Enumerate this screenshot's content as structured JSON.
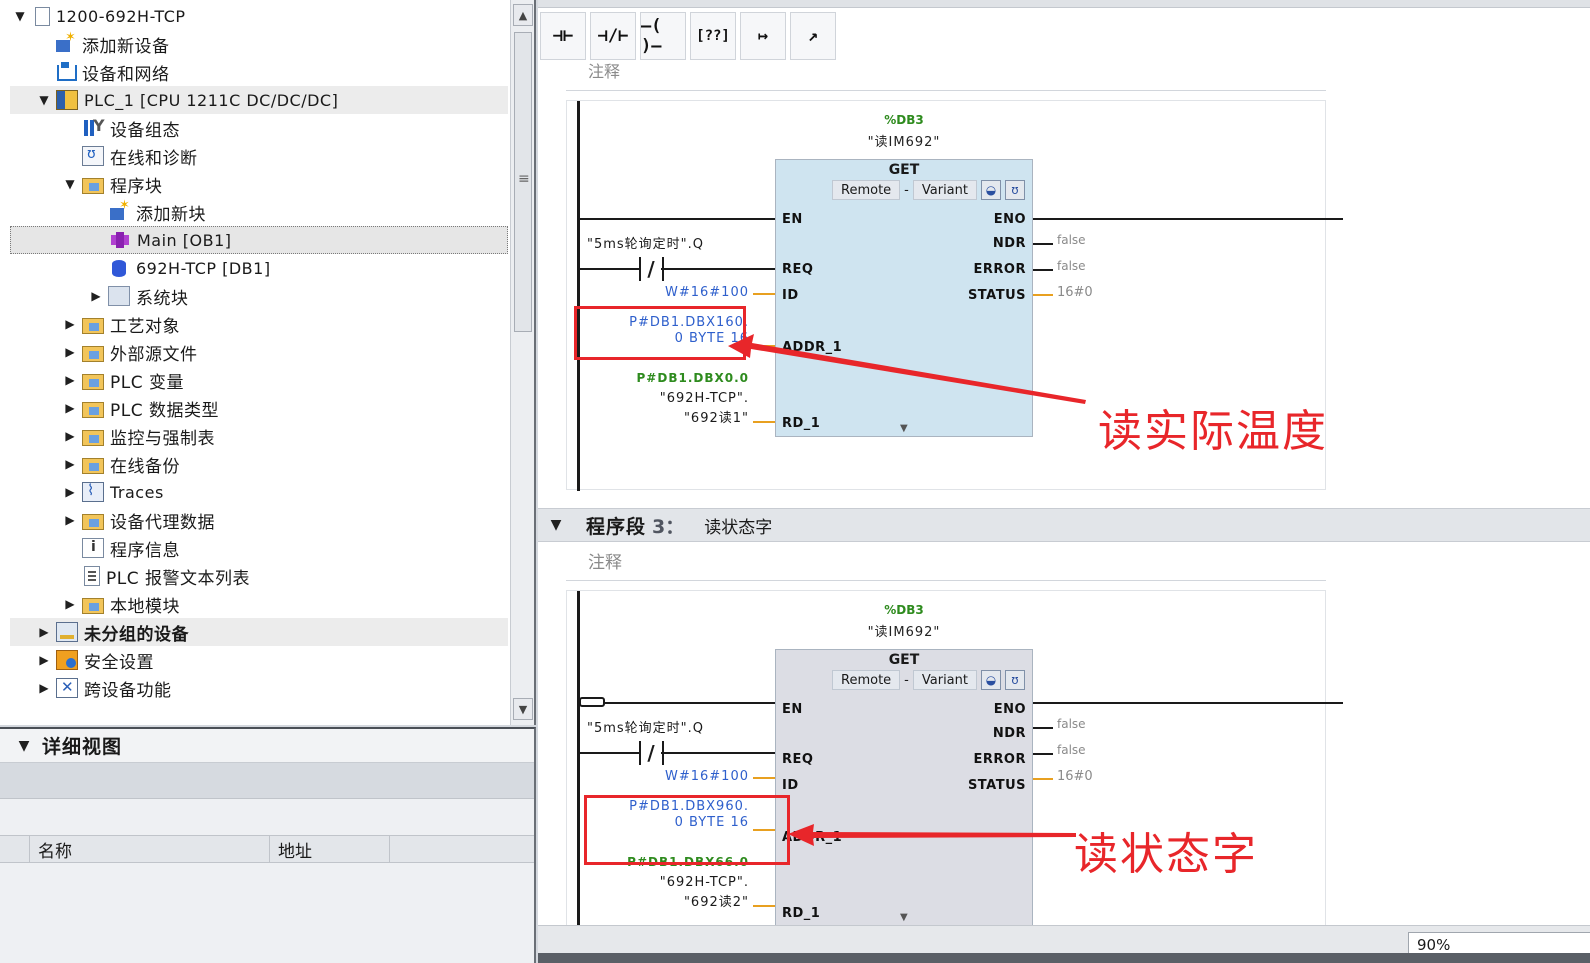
{
  "tree": {
    "items": [
      {
        "label": "1200-692H-TCP",
        "toggle": "▼",
        "icon": "document-icon"
      },
      {
        "label": "添加新设备",
        "toggle": "",
        "icon": "add-device-icon"
      },
      {
        "label": "设备和网络",
        "toggle": "",
        "icon": "network-icon"
      },
      {
        "label": "PLC_1 [CPU 1211C DC/DC/DC]",
        "toggle": "▼",
        "icon": "plc-icon"
      },
      {
        "label": "设备组态",
        "toggle": "",
        "icon": "device-config-icon"
      },
      {
        "label": "在线和诊断",
        "toggle": "",
        "icon": "diagnostics-icon"
      },
      {
        "label": "程序块",
        "toggle": "▼",
        "icon": "folder-icon"
      },
      {
        "label": "添加新块",
        "toggle": "",
        "icon": "add-block-icon"
      },
      {
        "label": "Main [OB1]",
        "toggle": "",
        "icon": "ob-block-icon"
      },
      {
        "label": "692H-TCP [DB1]",
        "toggle": "",
        "icon": "db-block-icon"
      },
      {
        "label": "系统块",
        "toggle": "▶",
        "icon": "system-block-icon"
      },
      {
        "label": "工艺对象",
        "toggle": "▶",
        "icon": "folder-icon"
      },
      {
        "label": "外部源文件",
        "toggle": "▶",
        "icon": "folder-icon"
      },
      {
        "label": "PLC 变量",
        "toggle": "▶",
        "icon": "folder-icon"
      },
      {
        "label": "PLC 数据类型",
        "toggle": "▶",
        "icon": "folder-icon"
      },
      {
        "label": "监控与强制表",
        "toggle": "▶",
        "icon": "folder-icon"
      },
      {
        "label": "在线备份",
        "toggle": "▶",
        "icon": "folder-icon"
      },
      {
        "label": "Traces",
        "toggle": "▶",
        "icon": "traces-icon"
      },
      {
        "label": "设备代理数据",
        "toggle": "▶",
        "icon": "folder-icon"
      },
      {
        "label": "程序信息",
        "toggle": "",
        "icon": "program-info-icon"
      },
      {
        "label": "PLC 报警文本列表",
        "toggle": "",
        "icon": "alarm-text-icon"
      },
      {
        "label": "本地模块",
        "toggle": "▶",
        "icon": "folder-icon"
      },
      {
        "label": "未分组的设备",
        "toggle": "▶",
        "icon": "ungrouped-devices-icon"
      },
      {
        "label": "安全设置",
        "toggle": "▶",
        "icon": "security-icon"
      },
      {
        "label": "跨设备功能",
        "toggle": "▶",
        "icon": "cross-device-icon"
      }
    ]
  },
  "detail": {
    "title": "详细视图",
    "columns": [
      "名称",
      "地址"
    ]
  },
  "toolbar": {
    "buttons": [
      "⊣⊢",
      "⊣/⊢",
      "–( )–",
      "[??]",
      "↦",
      "↗"
    ]
  },
  "editor": {
    "comment_label": "注释",
    "networks": [
      {
        "db_number": "%DB3",
        "db_name": "\"读IM692\"",
        "block_type": "GET",
        "param1": "Remote",
        "sep": "-",
        "param2": "Variant",
        "pins_left": [
          "EN",
          "REQ",
          "ID",
          "ADDR_1",
          "RD_1"
        ],
        "pins_right": [
          "ENO",
          "NDR",
          "ERROR",
          "STATUS"
        ],
        "contact_tag": "\"5ms轮询定时\".Q",
        "id_value": "W#16#100",
        "addr_value_line1": "P#DB1.DBX160.",
        "addr_value_line2": "0 BYTE 16",
        "rd_addr": "P#DB1.DBX0.0",
        "rd_tag_line1": "\"692H-TCP\".",
        "rd_tag_line2": "\"692读1\"",
        "ndr_value": "false",
        "error_value": "false",
        "status_value": "16#0",
        "annotation": "读实际温度"
      },
      {
        "db_number": "%DB3",
        "db_name": "\"读IM692\"",
        "block_type": "GET",
        "param1": "Remote",
        "sep": "-",
        "param2": "Variant",
        "pins_left": [
          "EN",
          "REQ",
          "ID",
          "ADDR_1",
          "RD_1"
        ],
        "pins_right": [
          "ENO",
          "NDR",
          "ERROR",
          "STATUS"
        ],
        "contact_tag": "\"5ms轮询定时\".Q",
        "id_value": "W#16#100",
        "addr_value_line1": "P#DB1.DBX960.",
        "addr_value_line2": "0 BYTE 16",
        "rd_addr": "P#DB1.DBX66.0",
        "rd_tag_line1": "\"692H-TCP\".",
        "rd_tag_line2": "\"692读2\"",
        "ndr_value": "false",
        "error_value": "false",
        "status_value": "16#0",
        "annotation": "读状态字"
      }
    ],
    "segment3": {
      "title": "程序段",
      "number": "3：",
      "subtitle": "读状态字"
    }
  },
  "statusbar": {
    "zoom": "90%"
  },
  "colors": {
    "fb_fill_active": "#cfe4f0",
    "fb_fill_inactive": "#dcdde4",
    "annotation_red": "#e8262a",
    "address_blue": "#2e5fcc",
    "db_green": "#2e8b1e"
  }
}
